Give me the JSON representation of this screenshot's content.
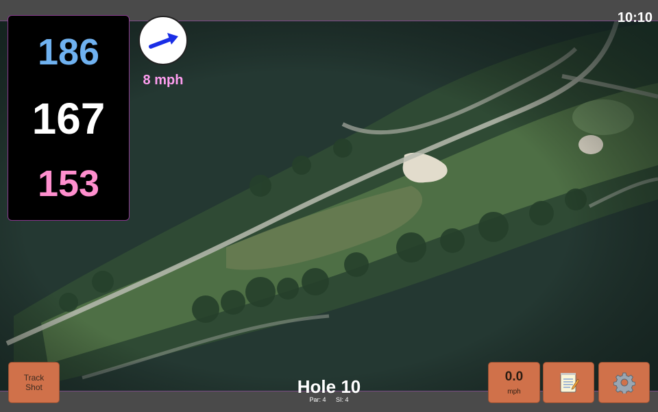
{
  "status": {
    "clock": "10:10"
  },
  "distances": {
    "back": "186",
    "middle": "167",
    "front": "153"
  },
  "wind": {
    "speed_label": "8 mph",
    "direction_icon": "wind-arrow-icon"
  },
  "controls": {
    "track_shot_label": "Track\nShot",
    "speed_value": "0.0",
    "speed_unit": "mph",
    "notes_icon": "notepad-icon",
    "settings_icon": "gear-icon"
  },
  "hole": {
    "title": "Hole 10",
    "par_label": "Par: 4",
    "si_label": "SI: 4"
  },
  "colors": {
    "back_distance": "#6fb1f0",
    "middle_distance": "#ffffff",
    "front_distance": "#ff8fce",
    "wind_label": "#ff9ef0",
    "button": "#d0714a",
    "wind_arrow": "#1a2ee6"
  }
}
